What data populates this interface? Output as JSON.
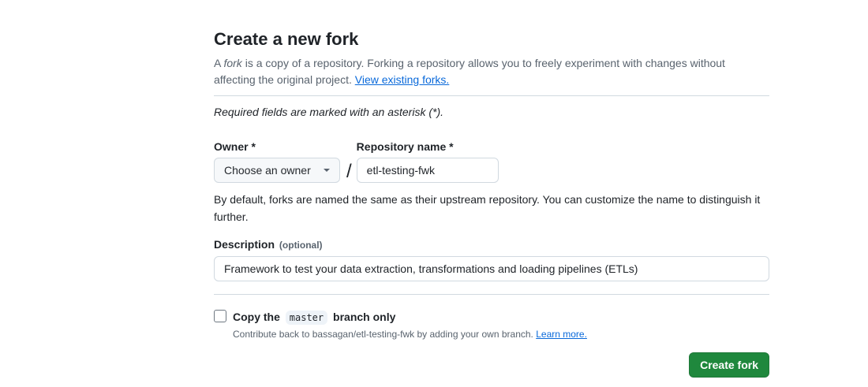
{
  "header": {
    "title": "Create a new fork",
    "intro_prefix": "A ",
    "intro_fork_word": "fork",
    "intro_middle": " is a copy of a repository. Forking a repository allows you to freely experiment with changes without affecting the original project. ",
    "intro_link": "View existing forks."
  },
  "form": {
    "required_note": "Required fields are marked with an asterisk (*).",
    "owner_label": "Owner *",
    "owner_select_value": "Choose an owner",
    "slash": "/",
    "repo_label": "Repository name *",
    "repo_value": "etl-testing-fwk",
    "help_text": "By default, forks are named the same as their upstream repository. You can customize the name to distinguish it further.",
    "description_label": "Description",
    "description_optional": "(optional)",
    "description_value": "Framework to test your data extraction, transformations and loading pipelines (ETLs)",
    "copy_prefix": "Copy the",
    "copy_branch": "master",
    "copy_suffix": "branch only",
    "copy_sub_text": "Contribute back to bassagan/etl-testing-fwk by adding your own branch. ",
    "copy_sub_link": "Learn more.",
    "copy_checked": false
  },
  "actions": {
    "create_fork_label": "Create fork"
  },
  "colors": {
    "primary_green": "#1f883d",
    "link_blue": "#0969da",
    "muted_text": "#59636e",
    "border": "#d1d9e0"
  }
}
